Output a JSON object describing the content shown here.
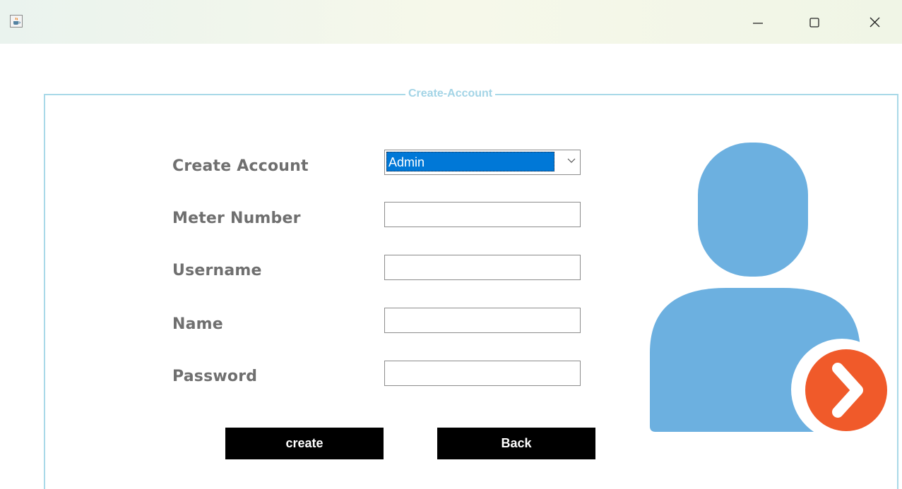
{
  "window": {
    "title": "",
    "controls": [
      "minimize",
      "maximize",
      "close"
    ]
  },
  "panel": {
    "legend": "Create-Account"
  },
  "form": {
    "create_account_label": "Create Account",
    "account_type": {
      "selected": "Admin"
    },
    "meter_number_label": "Meter Number",
    "meter_number_value": "",
    "username_label": "Username",
    "username_value": "",
    "name_label": "Name",
    "name_value": "",
    "password_label": "Password",
    "password_value": ""
  },
  "buttons": {
    "create": "create",
    "back": "Back"
  },
  "icons": {
    "app": "java-coffee-cup-icon",
    "user": "user-avatar-icon",
    "arrow": "arrow-right-circle-icon"
  },
  "colors": {
    "legend": "#a3d4e6",
    "border": "#a9d9e8",
    "label": "#6f6f6f",
    "selection": "#0078d7",
    "avatar": "#6cb0e0",
    "arrow_badge": "#f05a2a",
    "button_bg": "#000000"
  }
}
